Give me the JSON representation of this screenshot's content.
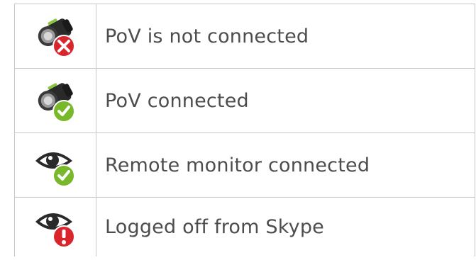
{
  "status_legend": {
    "rows": [
      {
        "icon": "webcam-disconnected-icon",
        "label": "PoV is not connected",
        "badge_color": "#d9262c"
      },
      {
        "icon": "webcam-connected-icon",
        "label": "PoV connected",
        "badge_color": "#78b82a"
      },
      {
        "icon": "eye-connected-icon",
        "label": "Remote monitor connected",
        "badge_color": "#78b82a"
      },
      {
        "icon": "eye-warning-icon",
        "label": "Logged off from Skype",
        "badge_color": "#d9262c"
      }
    ]
  }
}
